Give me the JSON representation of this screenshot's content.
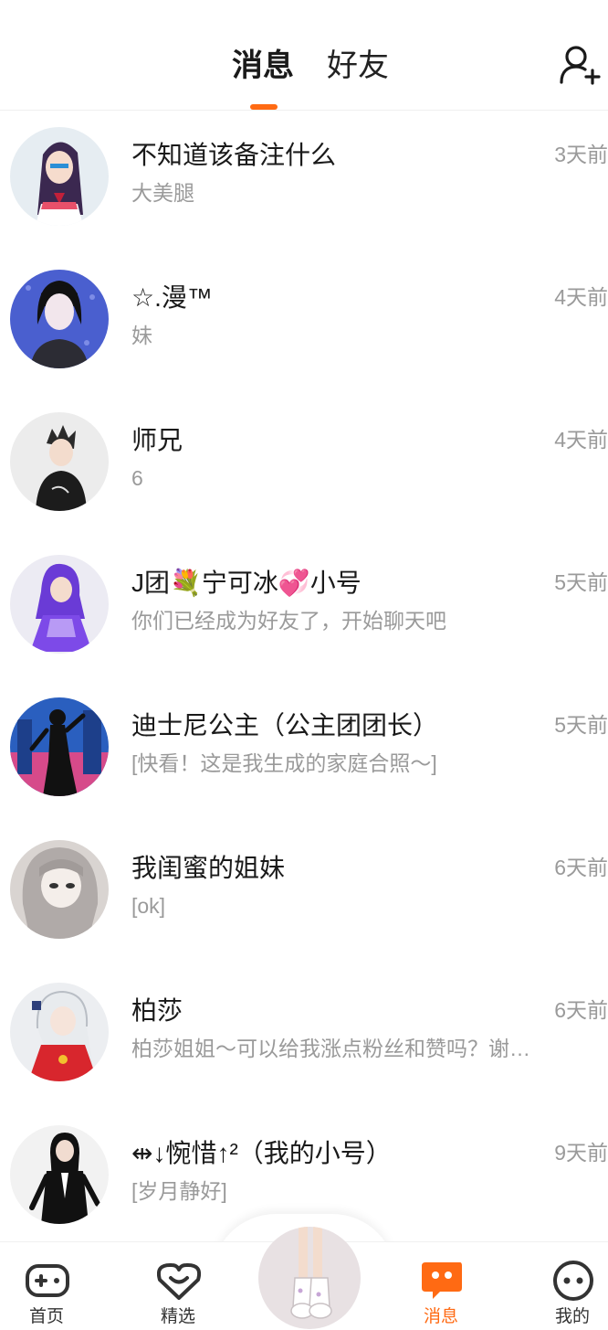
{
  "header": {
    "tabs": [
      {
        "label": "消息",
        "active": true
      },
      {
        "label": "好友",
        "active": false
      }
    ],
    "accent_color": "#ff6a13",
    "add_friend_icon": "add-user-icon"
  },
  "conversations": [
    {
      "name": "不知道该备注什么",
      "preview": "大美腿",
      "time": "3天前"
    },
    {
      "name": "☆.漫™",
      "preview": "妹",
      "time": "4天前"
    },
    {
      "name": "师兄",
      "preview": "6",
      "time": "4天前"
    },
    {
      "name": "J团💐宁可冰💞小号",
      "preview": "你们已经成为好友了，开始聊天吧",
      "time": "5天前"
    },
    {
      "name": "迪士尼公主（公主团团长）",
      "preview": "[快看！这是我生成的家庭合照～]",
      "time": "5天前"
    },
    {
      "name": "我闺蜜的姐妹",
      "preview": "[ok]",
      "time": "6天前"
    },
    {
      "name": "柏莎",
      "preview": "柏莎姐姐～可以给我涨点粉丝和赞吗？谢谢姐姐",
      "time": "6天前"
    },
    {
      "name": "⇹↓惋惜↑²（我的小号）",
      "preview": "[岁月静好]",
      "time": "9天前"
    }
  ],
  "bottom_nav": {
    "items": [
      {
        "label": "首页",
        "icon": "gamepad-icon",
        "active": false
      },
      {
        "label": "精选",
        "icon": "heart-chat-icon",
        "active": false
      },
      {
        "label": "消息",
        "icon": "message-bubble-icon",
        "active": true
      },
      {
        "label": "我的",
        "icon": "face-icon",
        "active": false
      }
    ]
  }
}
